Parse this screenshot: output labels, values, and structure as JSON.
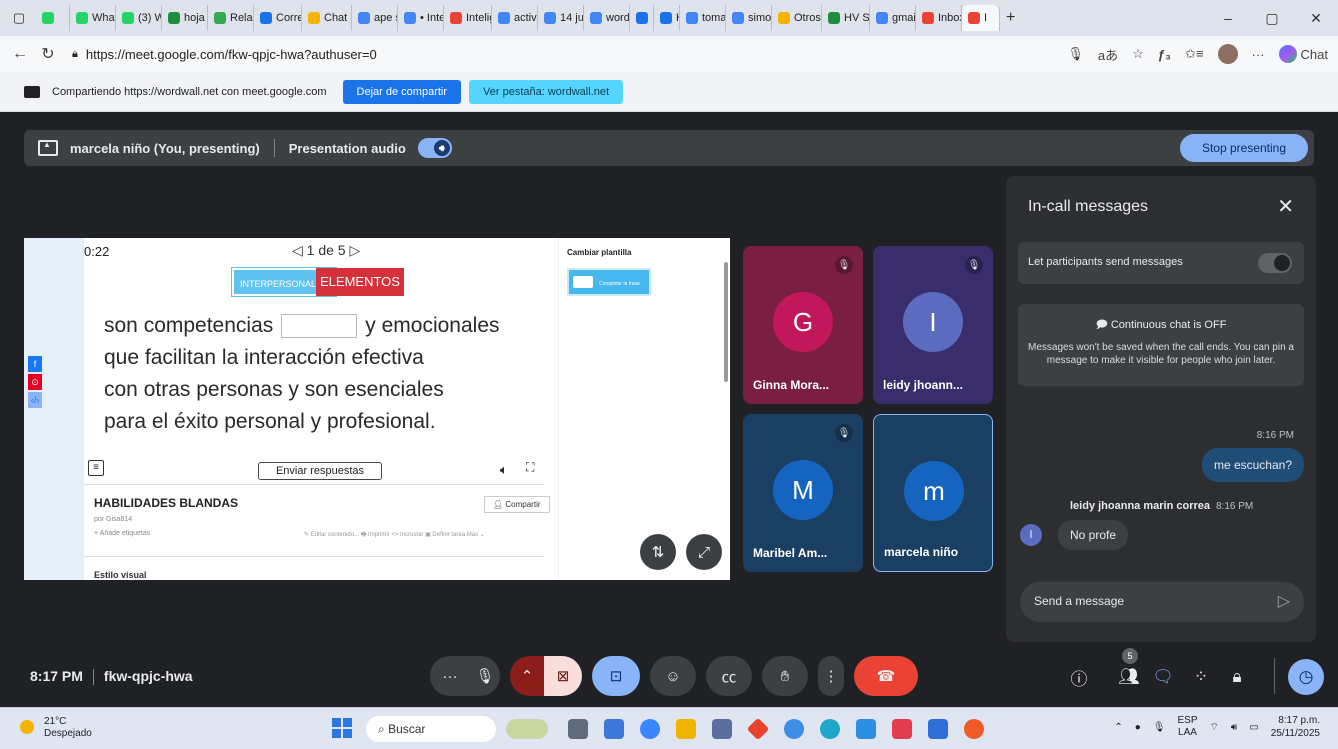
{
  "browser": {
    "tabs": [
      {
        "label": "",
        "color": "#25d366"
      },
      {
        "label": "What",
        "color": "#25d366"
      },
      {
        "label": "(3) W",
        "color": "#25d366"
      },
      {
        "label": "hoja c",
        "color": "#1e8e3e"
      },
      {
        "label": "Relac",
        "color": "#34a853"
      },
      {
        "label": "Corre",
        "color": "#1a73e8"
      },
      {
        "label": "Chat",
        "color": "#f4b400"
      },
      {
        "label": "ape s",
        "color": "#4285f4"
      },
      {
        "label": "• Inte",
        "color": "#4285f4"
      },
      {
        "label": "Intelig",
        "color": "#ea4335"
      },
      {
        "label": "activi",
        "color": "#4285f4"
      },
      {
        "label": "14 ju",
        "color": "#4285f4"
      },
      {
        "label": "word",
        "color": "#4285f4"
      },
      {
        "label": "",
        "color": "#1a73e8"
      },
      {
        "label": "H",
        "color": "#1a73e8"
      },
      {
        "label": "toma",
        "color": "#4285f4"
      },
      {
        "label": "simo",
        "color": "#4285f4"
      },
      {
        "label": "Otros",
        "color": "#f4b400"
      },
      {
        "label": "HV SI",
        "color": "#1e8e3e"
      },
      {
        "label": "gmai",
        "color": "#4285f4"
      },
      {
        "label": "Inbox",
        "color": "#ea4335"
      },
      {
        "label": "I",
        "color": "#ea4335"
      }
    ],
    "url": "https://meet.google.com/fkw-qpjc-hwa?authuser=0",
    "chat_label": "Chat"
  },
  "sharebar": {
    "text": "Compartiendo https://wordwall.net con meet.google.com",
    "stop_label": "Dejar de compartir",
    "view_label": "Ver pestaña: wordwall.net"
  },
  "presenting": {
    "user": "marcela niño (You, presenting)",
    "audio_label": "Presentation audio",
    "stop_label": "Stop presenting"
  },
  "activity": {
    "timer": "0:22",
    "pager": "◁ 1 de 5 ▷",
    "tag1": "INTERPERSONALES",
    "tag2": "ELEMENTOS",
    "line1a": "son competencias",
    "line1b": "y emocionales",
    "line2": "que facilitan la interacción efectiva",
    "line3": "con otras personas y son esenciales",
    "line4": "para el éxito personal y profesional.",
    "submit_label": "Enviar respuestas",
    "title": "HABILIDADES BLANDAS",
    "share_label": "Compartir",
    "by": "por  Gisa814",
    "add_tags": "+ Añade etiquetas",
    "actions": "✎ Editar contenido...   🖶 Imprimir   <> Incrustar   ▣ Definir tarea   Más ⌄",
    "visual_style": "Estilo visual",
    "template_title": "Cambiar plantilla",
    "template_chip": "Completar la frase"
  },
  "participants": [
    {
      "initial": "G",
      "name": "Ginna Mora...",
      "tile_color": "#7a1f42",
      "avatar_color": "#c2185b",
      "muted": true
    },
    {
      "initial": "I",
      "name": "leidy jhoann...",
      "tile_color": "#3a2d6b",
      "avatar_color": "#5c6bc0",
      "muted": true
    },
    {
      "initial": "M",
      "name": "Maribel Am...",
      "tile_color": "#1b3f63",
      "avatar_color": "#1565c0",
      "muted": true
    },
    {
      "initial": "m",
      "name": "marcela niño",
      "tile_color": "#1b3f63",
      "avatar_color": "#1565c0",
      "muted": false
    }
  ],
  "chat": {
    "title": "In-call messages",
    "permission_label": "Let participants send messages",
    "continuous_title": "Continuous chat is OFF",
    "continuous_body": "Messages won't be saved when the call ends. You can pin a message to make it visible for people who join later.",
    "my_time": "8:16 PM",
    "my_message": "me escuchan?",
    "sender_name": "leidy jhoanna marin correa",
    "sender_time": "8:16 PM",
    "sender_initial": "l",
    "their_message": "No profe",
    "composer_placeholder": "Send a message"
  },
  "meeting": {
    "time": "8:17 PM",
    "code": "fkw-qpjc-hwa",
    "people_count": "5"
  },
  "taskbar": {
    "temp": "21°C",
    "weather": "Despejado",
    "search_label": "Buscar",
    "lang1": "ESP",
    "lang2": "LAA",
    "time": "8:17 p.m.",
    "date": "25/11/2025"
  }
}
